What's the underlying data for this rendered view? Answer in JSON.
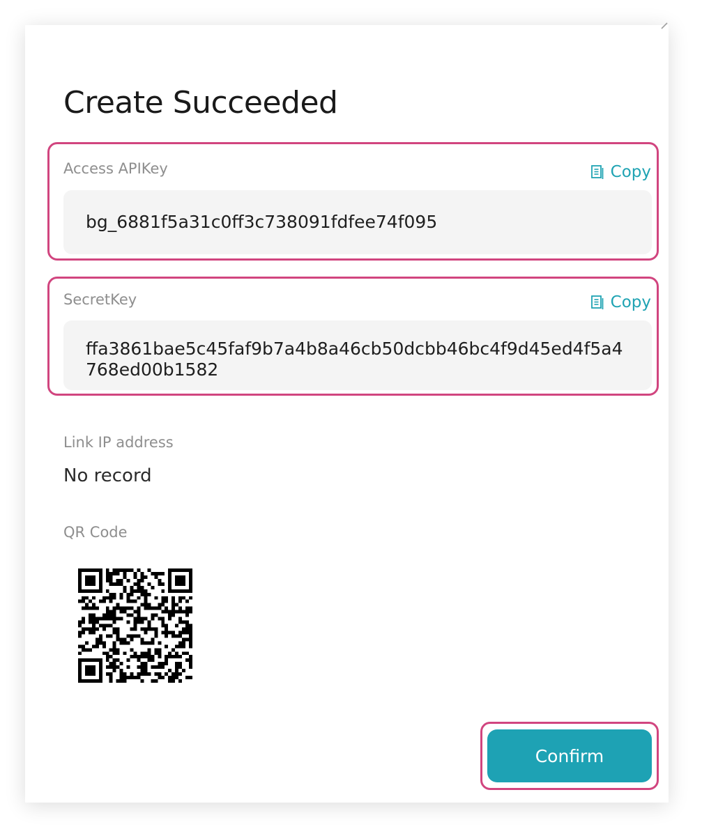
{
  "dialog": {
    "title": "Create Succeeded",
    "close_icon": "close-icon"
  },
  "access_key": {
    "label": "Access APIKey",
    "value": "bg_6881f5a31c0ff3c738091fdfee74f095",
    "copy_label": "Copy",
    "copy_icon": "clipboard-icon"
  },
  "secret_key": {
    "label": "SecretKey",
    "value": "ffa3861bae5c45faf9b7a4b8a46cb50dcbb46bc4f9d45ed4f5a4768ed00b1582",
    "copy_label": "Copy",
    "copy_icon": "clipboard-icon"
  },
  "link_ip": {
    "label": "Link IP address",
    "value": "No record"
  },
  "qr": {
    "label": "QR Code"
  },
  "actions": {
    "confirm_label": "Confirm"
  },
  "colors": {
    "accent": "#1ea2b4",
    "highlight": "#d1457f",
    "field_bg": "#f4f4f4",
    "label": "#8e8e8e"
  }
}
